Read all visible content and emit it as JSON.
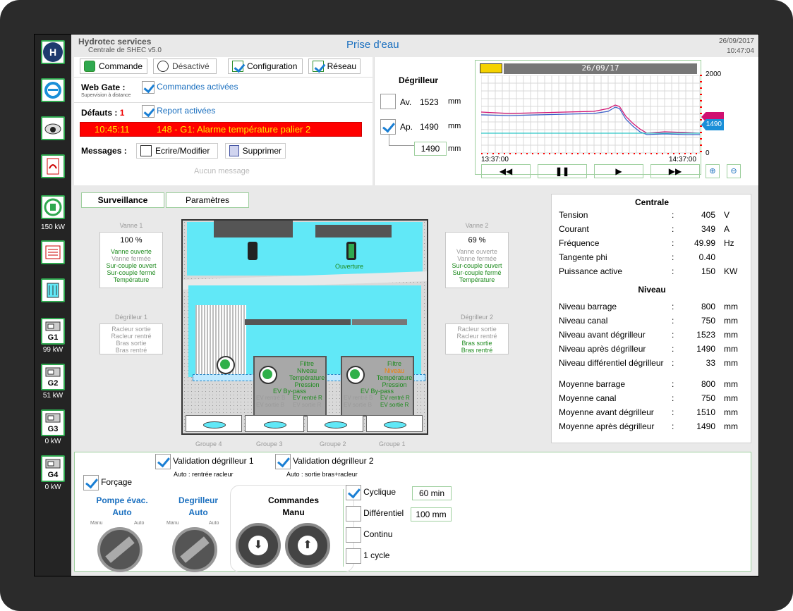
{
  "header": {
    "company": "Hydrotec services",
    "subtitle": "Centrale de SHEC v5.0",
    "title": "Prise d'eau",
    "date": "26/09/2017",
    "time": "10:47:04"
  },
  "sidebar": {
    "power_label": "150 kW",
    "g1": "G1",
    "g1_kw": "99 kW",
    "g2": "G2",
    "g2_kw": "51 kW",
    "g3": "G3",
    "g3_kw": "0 kW",
    "g4": "G4",
    "g4_kw": "0 kW"
  },
  "toolbar": {
    "commande": "Commande",
    "desactive": "Désactivé",
    "configuration": "Configuration",
    "reseau": "Réseau"
  },
  "webgate": {
    "label": "Web Gate :",
    "sub": "Supervision à distance",
    "commands": "Commandes activées"
  },
  "defauts": {
    "label": "Défauts :",
    "count": "1",
    "report": "Report activées",
    "alarm_time": "10:45:11",
    "alarm_text": "148 - G1: Alarme température palier 2"
  },
  "messages": {
    "label": "Messages :",
    "write": "Ecrire/Modifier",
    "delete": "Supprimer",
    "none": "Aucun message"
  },
  "degrilleur": {
    "title": "Dégrilleur",
    "av_label": "Av.",
    "av_value": "1523",
    "ap_label": "Ap.",
    "ap_value": "1490",
    "unit": "mm",
    "diff_value": "1490"
  },
  "trend": {
    "date": "26/09/17",
    "ymax": "2000",
    "ymin": "0",
    "current": "1490",
    "t_start": "13:37:00",
    "t_end": "14:37:00"
  },
  "tabs": {
    "surveillance": "Surveillance",
    "parametres": "Paramètres"
  },
  "vanne1": {
    "title": "Vanne 1",
    "pct": "100 %",
    "l1": "Vanne ouverte",
    "l2": "Vanne fermée",
    "l3": "Sur-couple ouvert",
    "l4": "Sur-couple fermé",
    "l5": "Température"
  },
  "vanne2": {
    "title": "Vanne 2",
    "pct": "69 %",
    "l1": "Vanne ouverte",
    "l2": "Vanne fermée",
    "l3": "Sur-couple ouvert",
    "l4": "Sur-couple fermé",
    "l5": "Température"
  },
  "degr1": {
    "title": "Dégrilleur 1",
    "l1": "Racleur sortie",
    "l2": "Racleur rentré",
    "l3": "Bras sortie",
    "l4": "Bras rentré"
  },
  "degr2": {
    "title": "Dégrilleur 2",
    "l1": "Racleur sortie",
    "l2": "Racleur rentré",
    "l3": "Bras sortie",
    "l4": "Bras rentré"
  },
  "synoptic": {
    "ouverture": "Ouverture",
    "f1": "Filtre",
    "f2": "Niveau",
    "f3": "Température",
    "f4": "Pression",
    "f5": "EV By-pass",
    "f6a": "EV rentré B",
    "f6b": "EV rentré R",
    "f7a": "EV sortie B",
    "f7b": "EV sortie R",
    "g4": "Groupe 4",
    "g3": "Groupe 3",
    "g2": "Groupe 2",
    "g1": "Groupe 1"
  },
  "centrale": {
    "title": "Centrale",
    "rows": [
      {
        "k": "Tension",
        "v": "405",
        "u": "V"
      },
      {
        "k": "Courant",
        "v": "349",
        "u": "A"
      },
      {
        "k": "Fréquence",
        "v": "49.99",
        "u": "Hz"
      },
      {
        "k": "Tangente phi",
        "v": "0.40",
        "u": ""
      },
      {
        "k": "Puissance active",
        "v": "150",
        "u": "KW"
      }
    ],
    "niveau_title": "Niveau",
    "niveau": [
      {
        "k": "Niveau barrage",
        "v": "800",
        "u": "mm"
      },
      {
        "k": "Niveau canal",
        "v": "750",
        "u": "mm"
      },
      {
        "k": "Niveau avant dégrilleur",
        "v": "1523",
        "u": "mm"
      },
      {
        "k": "Niveau après dégrilleur",
        "v": "1490",
        "u": "mm"
      },
      {
        "k": "Niveau différentiel dégrilleur",
        "v": "33",
        "u": "mm"
      }
    ],
    "moyennes": [
      {
        "k": "Moyenne barrage",
        "v": "800",
        "u": "mm"
      },
      {
        "k": "Moyenne canal",
        "v": "750",
        "u": "mm"
      },
      {
        "k": "Moyenne avant dégrilleur",
        "v": "1510",
        "u": "mm"
      },
      {
        "k": "Moyenne après dégrilleur",
        "v": "1490",
        "u": "mm"
      }
    ]
  },
  "controls": {
    "valid1": "Validation dégrilleur 1",
    "valid1_sub": "Auto : rentrée racleur",
    "valid2": "Validation dégrilleur 2",
    "valid2_sub": "Auto : sortie bras+racleur",
    "forcage": "Forçage",
    "pompe": "Pompe évac.",
    "pompe_mode": "Auto",
    "degr": "Degrilleur",
    "degr_mode": "Auto",
    "manu": "Manu",
    "auto": "Auto",
    "commandes": "Commandes",
    "commandes_mode": "Manu",
    "cyclique": "Cyclique",
    "cyclique_val": "60 min",
    "diff": "Différentiel",
    "diff_val": "100 mm",
    "continu": "Continu",
    "cycle": "1 cycle"
  },
  "colors": {
    "accent": "#1a6fbf",
    "green": "#2fa84f",
    "cyan": "#61e8f7",
    "alarm": "#ff0000"
  }
}
